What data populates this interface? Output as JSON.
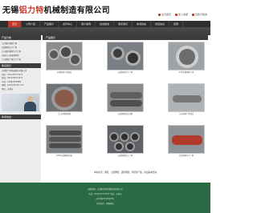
{
  "header": {
    "company_prefix": "无锡",
    "company_brand": "铝力特",
    "company_suffix": "机械制造有限公司",
    "links": [
      "设为首页",
      "加入收藏",
      "给我们留言"
    ]
  },
  "nav": {
    "items": [
      "首页",
      "公司介绍",
      "产品展示",
      "资讯中心",
      "客户案例",
      "在线留言",
      "联系我们",
      "新闻动态",
      "供应信息",
      "招聘"
    ]
  },
  "sidebar": {
    "products_title": "产品分类",
    "products": [
      "江苏镀锌钢管厂家",
      "无锡焊管生产厂家",
      "江苏镀锌钢管生产厂家",
      "无锡大口径直缝焊管",
      "江苏钢管厂家生产厂家"
    ],
    "contact_title": "联系我们",
    "contact": [
      "无锡铝力特机械制造有限公司",
      "电话：0510-83774271",
      "传真：0510-83774271",
      "手机：13861555888",
      "邮箱：wxlltjx@163.com",
      "地址：无锡市"
    ],
    "news_title": "新闻动态"
  },
  "main": {
    "title": "产品展示",
    "products": [
      "无缝钢管厂家批发",
      "无缝钢管生产厂家",
      "20#无缝钢管厂家",
      "大口径厚壁钢管",
      "无缝钢管供应商家",
      "江苏钢管厂家供应",
      "16Mn无缝钢管批发",
      "无缝钢管加工厂家",
      "合金钢管生产厂家"
    ],
    "note": "本站主营：钢管，无缝钢管，镀锌钢管，焊管等产品，欢迎来电咨询"
  },
  "footer": {
    "lines": [
      "版权所有：无锡铝力特机械制造有限公司",
      "电话：0510-83774271 地址：无锡市",
      "苏ICP备12345678号",
      "技术支持：网络科技"
    ]
  },
  "colors": {
    "accent": "#c0392b",
    "nav_bg": "#2f2f2f",
    "footer_bg": "#2a6b43",
    "sidebar_bg": "#ececec"
  }
}
